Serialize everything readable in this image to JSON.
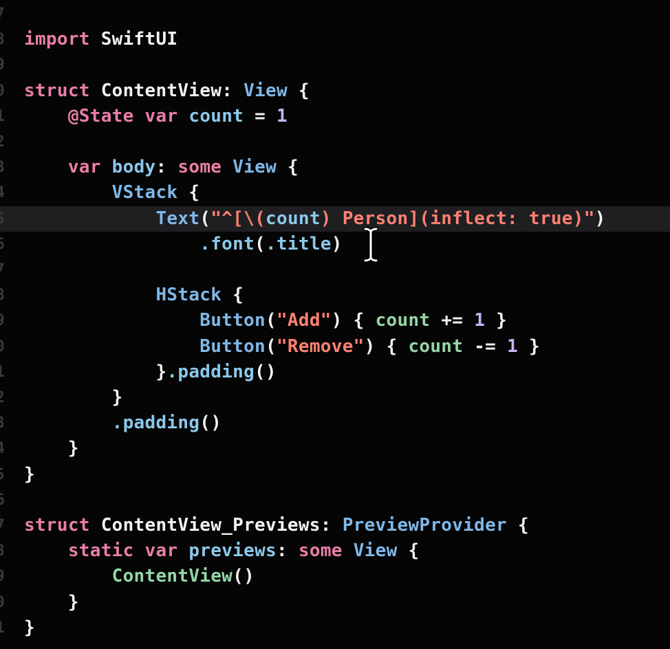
{
  "editor": {
    "gutter": [
      "7",
      "8",
      "9",
      "0",
      "1",
      "2",
      "3",
      "4",
      "5",
      "6",
      "7",
      "8",
      "9",
      "0",
      "1",
      "2",
      "3",
      "4",
      "5",
      "6",
      "7",
      "8",
      "9",
      "0",
      "1"
    ],
    "lines": [
      [],
      [
        {
          "t": "import",
          "c": "kw"
        },
        {
          "t": " SwiftUI",
          "c": "pl"
        }
      ],
      [],
      [
        {
          "t": "struct",
          "c": "kw"
        },
        {
          "t": " ContentView",
          "c": "pl"
        },
        {
          "t": ": ",
          "c": "pl"
        },
        {
          "t": "View",
          "c": "typ"
        },
        {
          "t": " {",
          "c": "pl"
        }
      ],
      [
        {
          "t": "    ",
          "c": "pl"
        },
        {
          "t": "@State",
          "c": "kw"
        },
        {
          "t": " ",
          "c": "pl"
        },
        {
          "t": "var",
          "c": "kw"
        },
        {
          "t": " count",
          "c": "id"
        },
        {
          "t": " = ",
          "c": "pl"
        },
        {
          "t": "1",
          "c": "num"
        }
      ],
      [],
      [
        {
          "t": "    ",
          "c": "pl"
        },
        {
          "t": "var",
          "c": "kw"
        },
        {
          "t": " body",
          "c": "id"
        },
        {
          "t": ": ",
          "c": "pl"
        },
        {
          "t": "some",
          "c": "kw"
        },
        {
          "t": " ",
          "c": "pl"
        },
        {
          "t": "View",
          "c": "typ"
        },
        {
          "t": " {",
          "c": "pl"
        }
      ],
      [
        {
          "t": "        ",
          "c": "pl"
        },
        {
          "t": "VStack",
          "c": "typ"
        },
        {
          "t": " {",
          "c": "pl"
        }
      ],
      [
        {
          "t": "            ",
          "c": "pl"
        },
        {
          "t": "Text",
          "c": "typ"
        },
        {
          "t": "(",
          "c": "pl"
        },
        {
          "t": "\"^[\\(",
          "c": "str"
        },
        {
          "t": "count",
          "c": "id"
        },
        {
          "t": ") Person](inflect: true)\"",
          "c": "str"
        },
        {
          "t": ")",
          "c": "pl"
        }
      ],
      [
        {
          "t": "                ",
          "c": "pl"
        },
        {
          "t": ".font",
          "c": "id"
        },
        {
          "t": "(",
          "c": "pl"
        },
        {
          "t": ".title",
          "c": "id"
        },
        {
          "t": ")",
          "c": "pl"
        }
      ],
      [],
      [
        {
          "t": "            ",
          "c": "pl"
        },
        {
          "t": "HStack",
          "c": "typ"
        },
        {
          "t": " {",
          "c": "pl"
        }
      ],
      [
        {
          "t": "                ",
          "c": "pl"
        },
        {
          "t": "Button",
          "c": "typ"
        },
        {
          "t": "(",
          "c": "pl"
        },
        {
          "t": "\"Add\"",
          "c": "str"
        },
        {
          "t": ") { ",
          "c": "pl"
        },
        {
          "t": "count",
          "c": "fn"
        },
        {
          "t": " += ",
          "c": "pl"
        },
        {
          "t": "1",
          "c": "num"
        },
        {
          "t": " }",
          "c": "pl"
        }
      ],
      [
        {
          "t": "                ",
          "c": "pl"
        },
        {
          "t": "Button",
          "c": "typ"
        },
        {
          "t": "(",
          "c": "pl"
        },
        {
          "t": "\"Remove\"",
          "c": "str"
        },
        {
          "t": ") { ",
          "c": "pl"
        },
        {
          "t": "count",
          "c": "fn"
        },
        {
          "t": " -= ",
          "c": "pl"
        },
        {
          "t": "1",
          "c": "num"
        },
        {
          "t": " }",
          "c": "pl"
        }
      ],
      [
        {
          "t": "            }",
          "c": "pl"
        },
        {
          "t": ".padding",
          "c": "id"
        },
        {
          "t": "()",
          "c": "pl"
        }
      ],
      [
        {
          "t": "        }",
          "c": "pl"
        }
      ],
      [
        {
          "t": "        ",
          "c": "pl"
        },
        {
          "t": ".padding",
          "c": "id"
        },
        {
          "t": "()",
          "c": "pl"
        }
      ],
      [
        {
          "t": "    }",
          "c": "pl"
        }
      ],
      [
        {
          "t": "}",
          "c": "pl"
        }
      ],
      [],
      [
        {
          "t": "struct",
          "c": "kw"
        },
        {
          "t": " ContentView_Previews",
          "c": "pl"
        },
        {
          "t": ": ",
          "c": "pl"
        },
        {
          "t": "PreviewProvider",
          "c": "typ"
        },
        {
          "t": " {",
          "c": "pl"
        }
      ],
      [
        {
          "t": "    ",
          "c": "pl"
        },
        {
          "t": "static",
          "c": "kw"
        },
        {
          "t": " ",
          "c": "pl"
        },
        {
          "t": "var",
          "c": "kw"
        },
        {
          "t": " previews",
          "c": "id"
        },
        {
          "t": ": ",
          "c": "pl"
        },
        {
          "t": "some",
          "c": "kw"
        },
        {
          "t": " ",
          "c": "pl"
        },
        {
          "t": "View",
          "c": "typ"
        },
        {
          "t": " {",
          "c": "pl"
        }
      ],
      [
        {
          "t": "        ",
          "c": "pl"
        },
        {
          "t": "ContentView",
          "c": "fn"
        },
        {
          "t": "()",
          "c": "pl"
        }
      ],
      [
        {
          "t": "    }",
          "c": "pl"
        }
      ],
      [
        {
          "t": "}",
          "c": "pl"
        }
      ]
    ]
  },
  "colors": {
    "background": "#050505",
    "current_line": "#1f1f22",
    "keyword": "#e87ea8",
    "type": "#7fb8e8",
    "identifier": "#8cc8ea",
    "function": "#95d6a6",
    "number": "#c9b2f2",
    "string": "#ff8170",
    "plain": "#f2f2f2"
  },
  "cursor_icon": "i-beam-cursor-icon"
}
